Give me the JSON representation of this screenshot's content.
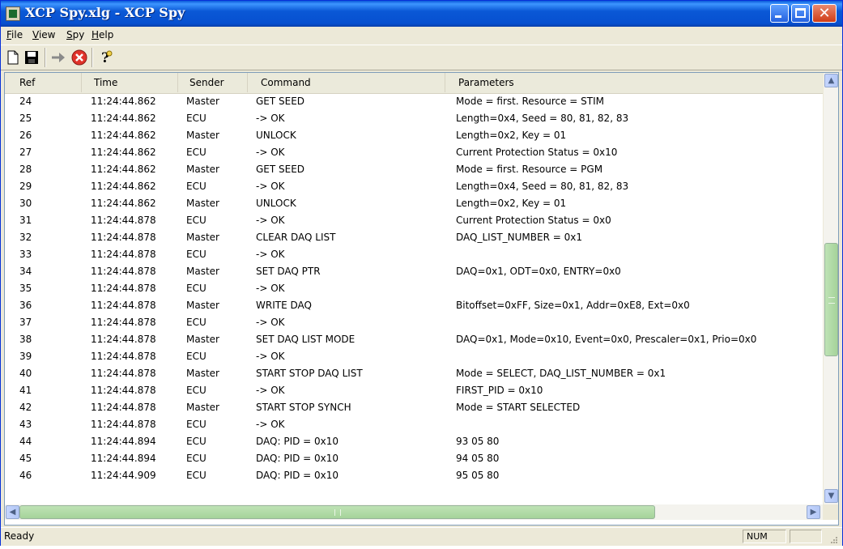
{
  "window": {
    "title": "XCP Spy.xlg - XCP Spy"
  },
  "menu": [
    "File",
    "View",
    "Spy",
    "Help"
  ],
  "menu_underline": [
    "F",
    "V",
    "S",
    "H"
  ],
  "toolbar": {
    "icons": [
      "new-document-icon",
      "save-icon",
      "go-arrow-icon",
      "stop-icon",
      "help-icon"
    ]
  },
  "table": {
    "columns": [
      "Ref",
      "Time",
      "Sender",
      "Command",
      "Parameters"
    ],
    "rows": [
      [
        "24",
        "11:24:44.862",
        "Master",
        "GET SEED",
        "Mode = first. Resource = STIM"
      ],
      [
        "25",
        "11:24:44.862",
        "ECU",
        " -> OK",
        "Length=0x4, Seed = 80, 81, 82, 83"
      ],
      [
        "26",
        "11:24:44.862",
        "Master",
        "UNLOCK",
        "Length=0x2, Key = 01"
      ],
      [
        "27",
        "11:24:44.862",
        "ECU",
        " -> OK",
        "Current Protection Status = 0x10"
      ],
      [
        "28",
        "11:24:44.862",
        "Master",
        "GET SEED",
        "Mode = first. Resource = PGM"
      ],
      [
        "29",
        "11:24:44.862",
        "ECU",
        " -> OK",
        "Length=0x4, Seed = 80, 81, 82, 83"
      ],
      [
        "30",
        "11:24:44.862",
        "Master",
        "UNLOCK",
        "Length=0x2, Key = 01"
      ],
      [
        "31",
        "11:24:44.878",
        "ECU",
        " -> OK",
        "Current Protection Status = 0x0"
      ],
      [
        "32",
        "11:24:44.878",
        "Master",
        "CLEAR DAQ LIST",
        "DAQ_LIST_NUMBER = 0x1"
      ],
      [
        "33",
        "11:24:44.878",
        "ECU",
        " -> OK",
        ""
      ],
      [
        "34",
        "11:24:44.878",
        "Master",
        "SET DAQ PTR",
        "DAQ=0x1, ODT=0x0, ENTRY=0x0"
      ],
      [
        "35",
        "11:24:44.878",
        "ECU",
        " -> OK",
        ""
      ],
      [
        "36",
        "11:24:44.878",
        "Master",
        "WRITE DAQ",
        "Bitoffset=0xFF, Size=0x1, Addr=0xE8, Ext=0x0"
      ],
      [
        "37",
        "11:24:44.878",
        "ECU",
        " -> OK",
        ""
      ],
      [
        "38",
        "11:24:44.878",
        "Master",
        "SET DAQ LIST MODE",
        "DAQ=0x1, Mode=0x10, Event=0x0, Prescaler=0x1, Prio=0x0"
      ],
      [
        "39",
        "11:24:44.878",
        "ECU",
        " -> OK",
        ""
      ],
      [
        "40",
        "11:24:44.878",
        "Master",
        "START STOP DAQ LIST",
        "Mode = SELECT, DAQ_LIST_NUMBER = 0x1"
      ],
      [
        "41",
        "11:24:44.878",
        "ECU",
        " -> OK",
        "FIRST_PID = 0x10"
      ],
      [
        "42",
        "11:24:44.878",
        "Master",
        "START STOP SYNCH",
        "Mode = START SELECTED"
      ],
      [
        "43",
        "11:24:44.878",
        "ECU",
        " -> OK",
        ""
      ],
      [
        "44",
        "11:24:44.894",
        "ECU",
        "DAQ: PID = 0x10",
        "93 05 80"
      ],
      [
        "45",
        "11:24:44.894",
        "ECU",
        "DAQ: PID = 0x10",
        "94 05 80"
      ],
      [
        "46",
        "11:24:44.909",
        "ECU",
        "DAQ: PID = 0x10",
        "95 05 80"
      ]
    ]
  },
  "status": {
    "text": "Ready",
    "num": "NUM"
  },
  "colors": {
    "title_blue": "#0a58d6",
    "close_red": "#d03c17",
    "scroll_green": "#a5d39a"
  }
}
